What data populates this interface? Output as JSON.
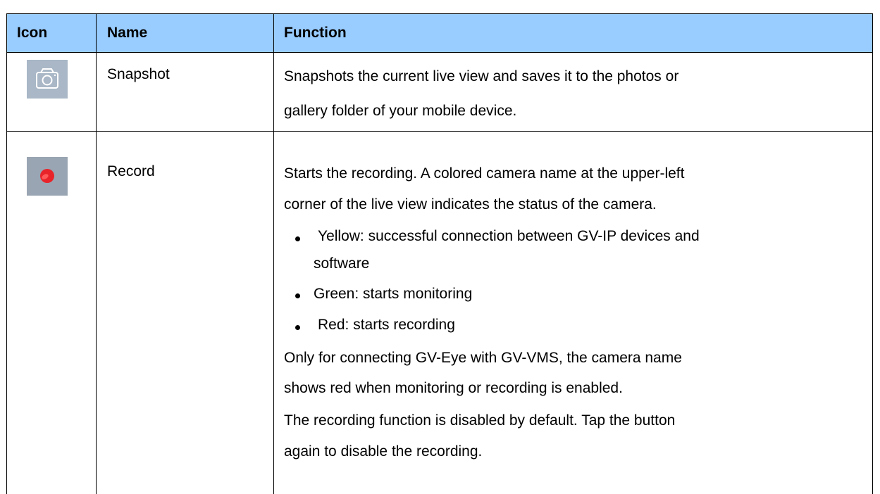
{
  "table": {
    "headers": {
      "icon": "Icon",
      "name": "Name",
      "function": "Function"
    },
    "rows": [
      {
        "icon": "camera-icon",
        "name": "Snapshot",
        "function_lines": [
          "Snapshots the current live view and saves it to the photos or",
          "gallery folder of your mobile device."
        ]
      },
      {
        "icon": "record-icon",
        "name": "Record",
        "function_intro": [
          "Starts the recording. A colored camera name at the upper-left",
          "corner of the live view indicates the status of the camera."
        ],
        "bullets": [
          [
            "Yellow: successful connection between GV-IP devices and",
            "software"
          ],
          [
            "Green: starts monitoring"
          ],
          [
            "Red: starts recording"
          ]
        ],
        "note1": [
          "Only for connecting GV-Eye with GV-VMS, the camera name",
          "shows red when monitoring or recording is enabled."
        ],
        "note2": [
          "The recording function is disabled by default. Tap the button",
          "again to disable the recording."
        ]
      }
    ]
  },
  "colors": {
    "header_bg": "#99ccff",
    "record_dot": "#e8242a"
  }
}
